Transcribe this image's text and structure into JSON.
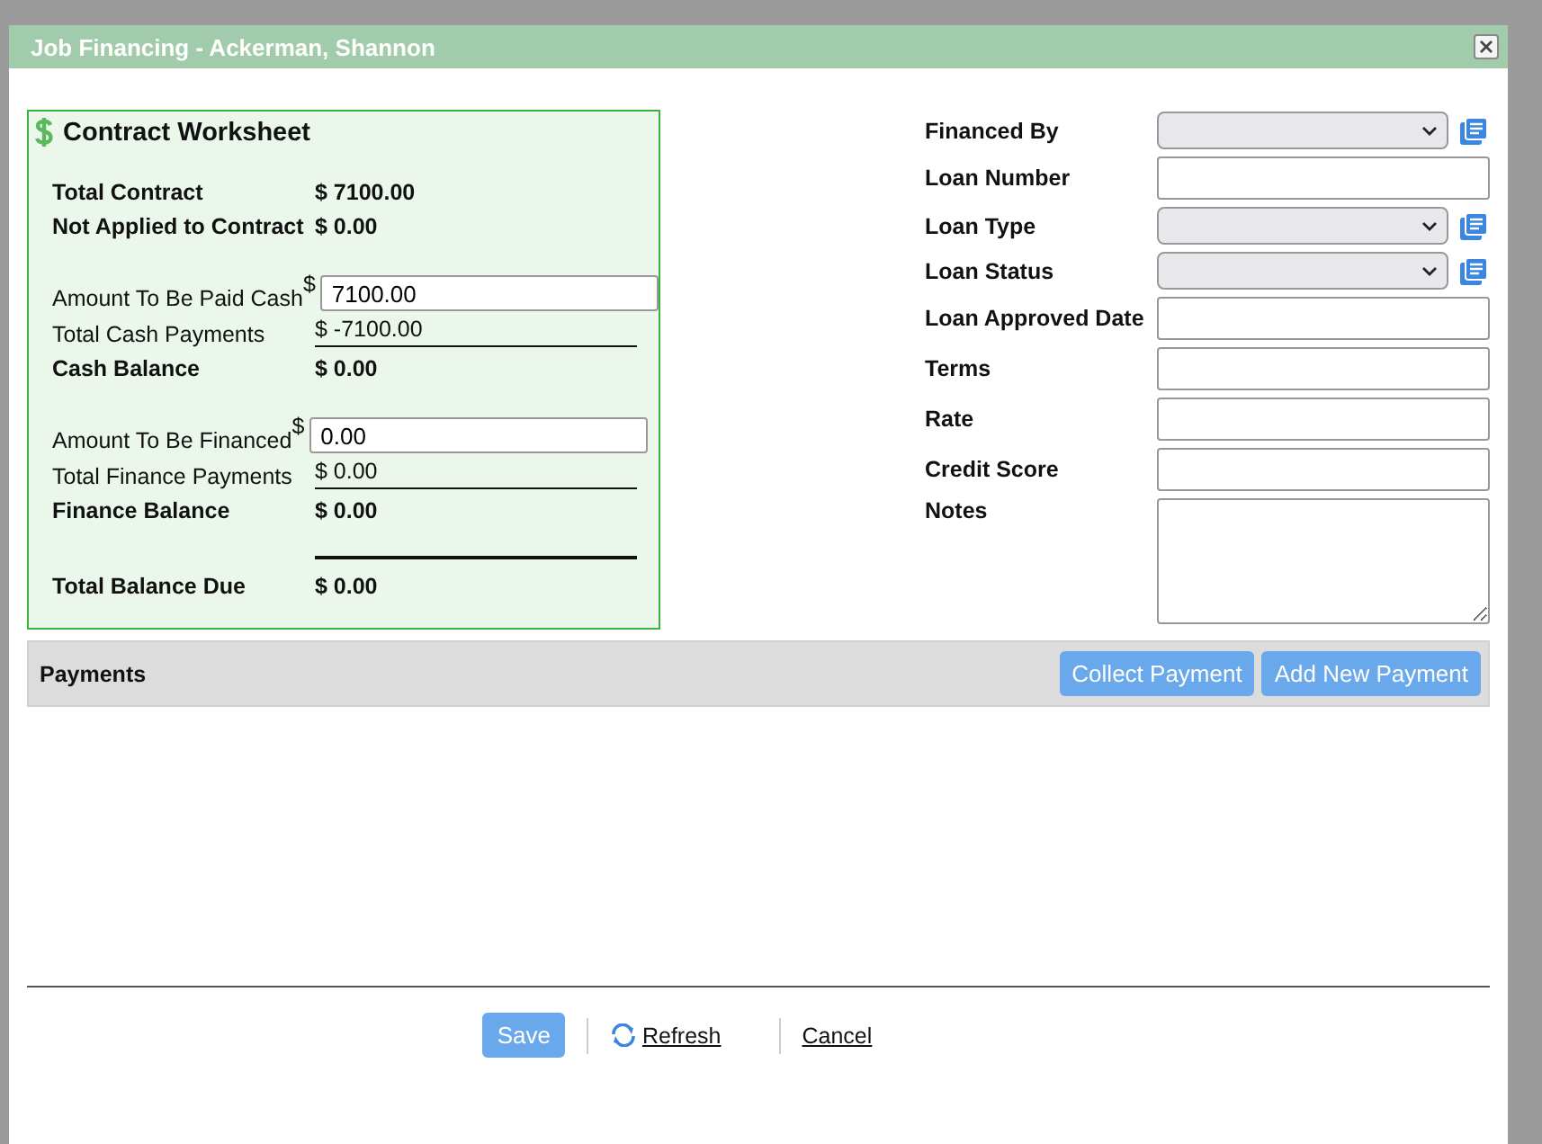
{
  "window": {
    "title": "Job Financing - Ackerman, Shannon"
  },
  "worksheet": {
    "title": "Contract Worksheet",
    "sections": [
      [
        {
          "kind": "static",
          "label": "Total Contract",
          "value": "$ 7100.00",
          "bold": true
        },
        {
          "kind": "static",
          "label": "Not Applied to Contract",
          "value": "$ 0.00",
          "bold": true
        }
      ],
      [
        {
          "kind": "input",
          "label": "Amount To Be Paid Cash",
          "currency": "$",
          "value": "7100.00",
          "bold": false
        },
        {
          "kind": "static",
          "label": "Total Cash Payments",
          "value": "$ -7100.00",
          "bold": false,
          "underline": true
        },
        {
          "kind": "static",
          "label": "Cash Balance",
          "value": "$ 0.00",
          "bold": true
        }
      ],
      [
        {
          "kind": "input",
          "label": "Amount To Be Financed",
          "currency": "$",
          "value": "0.00",
          "bold": false
        },
        {
          "kind": "static",
          "label": "Total Finance Payments",
          "value": "$ 0.00",
          "bold": false,
          "underline": true
        },
        {
          "kind": "static",
          "label": "Finance Balance",
          "value": "$ 0.00",
          "bold": true
        }
      ],
      [
        {
          "kind": "static",
          "label": "Total Balance Due",
          "value": "$ 0.00",
          "bold": true,
          "overline": true
        }
      ]
    ]
  },
  "loan_form": [
    {
      "kind": "select",
      "label": "Financed By"
    },
    {
      "kind": "text",
      "label": "Loan Number"
    },
    {
      "kind": "select",
      "label": "Loan Type"
    },
    {
      "kind": "select",
      "label": "Loan Status"
    },
    {
      "kind": "text",
      "label": "Loan Approved Date"
    },
    {
      "kind": "text",
      "label": "Terms"
    },
    {
      "kind": "text",
      "label": "Rate"
    },
    {
      "kind": "text",
      "label": "Credit Score"
    },
    {
      "kind": "textarea",
      "label": "Notes"
    }
  ],
  "payments": {
    "title": "Payments",
    "buttons": [
      "Collect Payment",
      "Add New Payment"
    ]
  },
  "footer": {
    "save": "Save",
    "refresh": "Refresh",
    "cancel": "Cancel"
  }
}
